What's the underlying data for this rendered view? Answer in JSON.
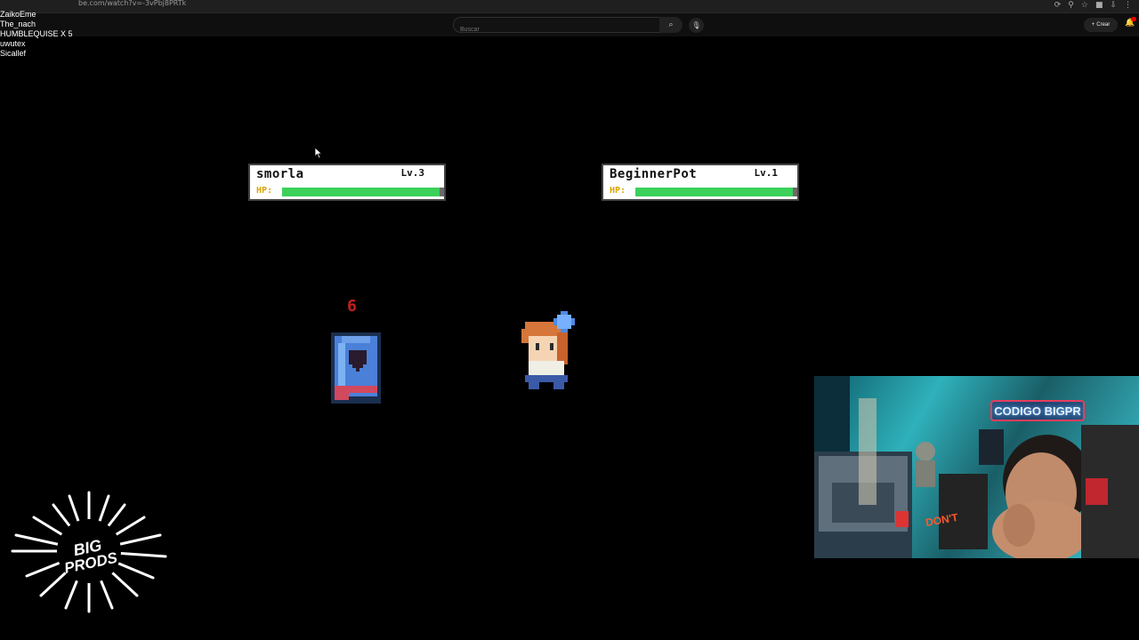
{
  "browser": {
    "url": "be.com/watch?v=-3vPbj8PRTk"
  },
  "youtube": {
    "search_placeholder": "Buscar",
    "create_label": "Crear"
  },
  "overlay": {
    "viewer_names": [
      "ZaikoEme",
      "The_nach",
      "HUMBLEQUISE X 5",
      "uwutex",
      "Sicallef"
    ]
  },
  "battle": {
    "player": {
      "name": "smorla",
      "level": "Lv.3",
      "hp_label": "HP:",
      "hp_fraction": 0.97
    },
    "enemy": {
      "name": "BeginnerPot",
      "level": "Lv.1",
      "hp_label": "HP:",
      "hp_fraction": 0.97
    },
    "damage_number": "6"
  },
  "webcam": {
    "neon_sign": "CODIGO BIGPR",
    "sticker_text": "DON'T"
  },
  "logo": {
    "line1": "BIG",
    "line2": "PRODS"
  },
  "colors": {
    "hp_fill": "#3bd15a",
    "hp_track": "#6a6a6a",
    "hp_label": "#d9a400",
    "damage": "#c4201e"
  }
}
